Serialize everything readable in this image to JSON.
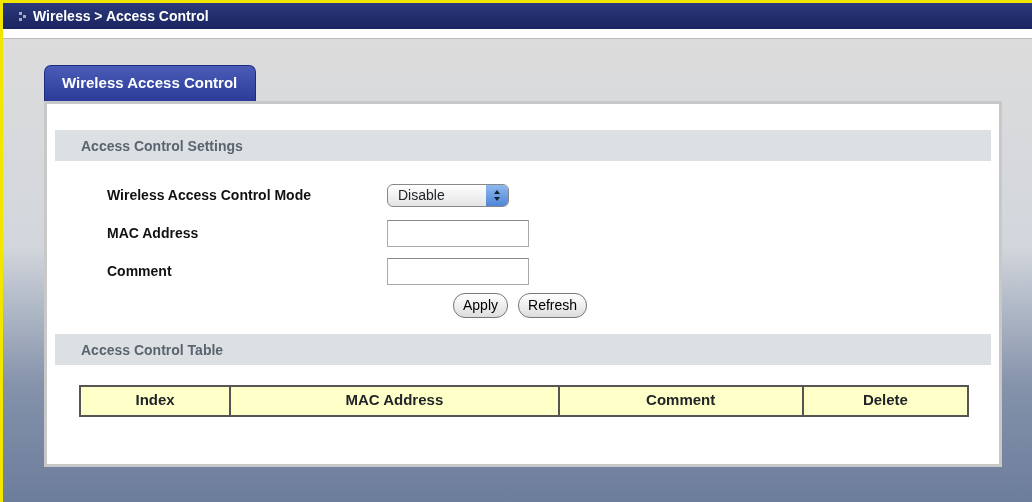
{
  "breadcrumb": "Wireless > Access Control",
  "tabs": [
    {
      "label": "Wireless Access Control",
      "selected": true
    }
  ],
  "settings": {
    "heading": "Access Control Settings",
    "fields": [
      {
        "kind": "select",
        "label": "Wireless Access Control Mode",
        "value": "Disable"
      },
      {
        "kind": "text",
        "label": "MAC Address"
      },
      {
        "kind": "text",
        "label": "Comment"
      }
    ],
    "buttons": [
      "Apply",
      "Refresh"
    ]
  },
  "table": {
    "heading": "Access Control Table",
    "columns": [
      "Index",
      "MAC Address",
      "Comment",
      "Delete"
    ]
  }
}
